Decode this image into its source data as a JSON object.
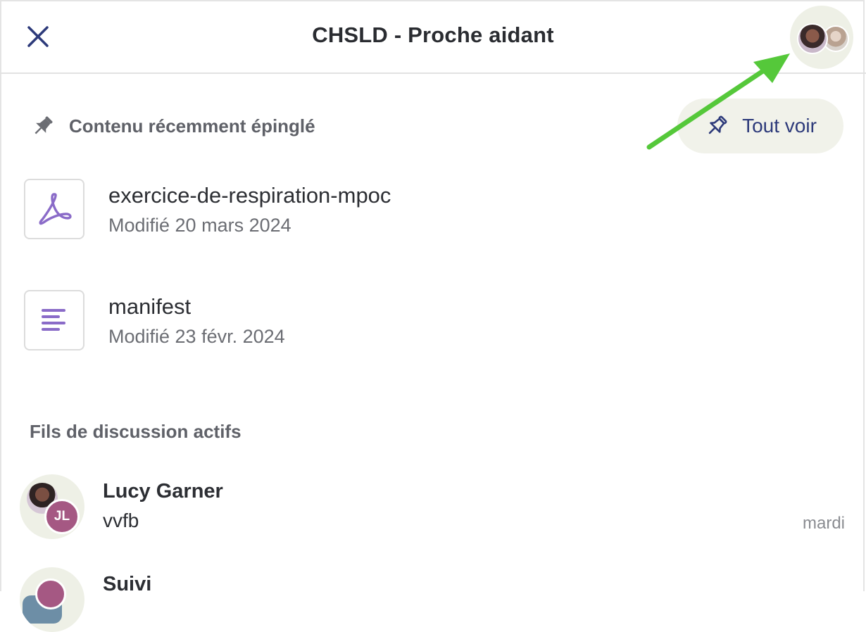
{
  "header": {
    "title": "CHSLD - Proche aidant"
  },
  "pinned": {
    "heading": "Contenu récemment épinglé",
    "see_all_label": "Tout voir",
    "files": [
      {
        "name": "exercice-de-respiration-mpoc",
        "meta": "Modifié 20 mars 2024",
        "icon": "pdf-icon"
      },
      {
        "name": "manifest",
        "meta": "Modifié 23 févr. 2024",
        "icon": "document-icon"
      }
    ]
  },
  "threads": {
    "heading": "Fils de discussion actifs",
    "items": [
      {
        "name": "Lucy Garner",
        "preview": "vvfb",
        "date": "mardi",
        "initials": "JL"
      },
      {
        "name": "Suivi",
        "preview": "",
        "date": ""
      }
    ]
  },
  "colors": {
    "accent_purple": "#8a6bc8",
    "button_text": "#2d3a7a",
    "avatar_jl": "#a55883",
    "annotation_arrow": "#55c83a"
  }
}
